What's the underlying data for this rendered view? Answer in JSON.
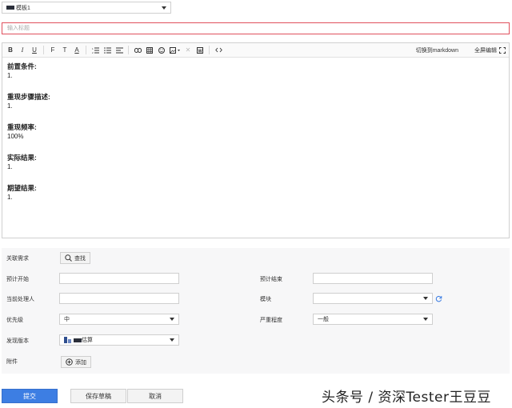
{
  "template": {
    "value": "模板1"
  },
  "title": {
    "placeholder": "输入标题"
  },
  "toolbar": {
    "bold": "B",
    "italic": "I",
    "underline": "U",
    "font": "F",
    "size": "T",
    "color": "A",
    "markdown": "切换到markdown",
    "fullscreen": "全屏编辑"
  },
  "content": {
    "sections": [
      {
        "title": "前置条件:",
        "body": "1."
      },
      {
        "title": "重现步骤描述:",
        "body": "1."
      },
      {
        "title": "重现频率:",
        "body": "100%"
      },
      {
        "title": "实际结果:",
        "body": "1."
      },
      {
        "title": "期望结果:",
        "body": "1."
      }
    ]
  },
  "form": {
    "related_label": "关联需求",
    "search_button": "查找",
    "start_label": "预计开始",
    "end_label": "预计结束",
    "assignee_label": "当前处理人",
    "module_label": "模块",
    "priority_label": "优先级",
    "priority_value": "中",
    "severity_label": "严重程度",
    "severity_value": "一般",
    "version_label": "发现版本",
    "version_value": "估算",
    "attachment_label": "附件",
    "add_button": "添加"
  },
  "actions": {
    "submit": "提交",
    "save_draft": "保存草稿",
    "cancel": "取消"
  },
  "watermark": "头条号 / 资深Tester王豆豆",
  "colors": {
    "primary": "#3d7ee3",
    "error_border": "#e0505d"
  }
}
